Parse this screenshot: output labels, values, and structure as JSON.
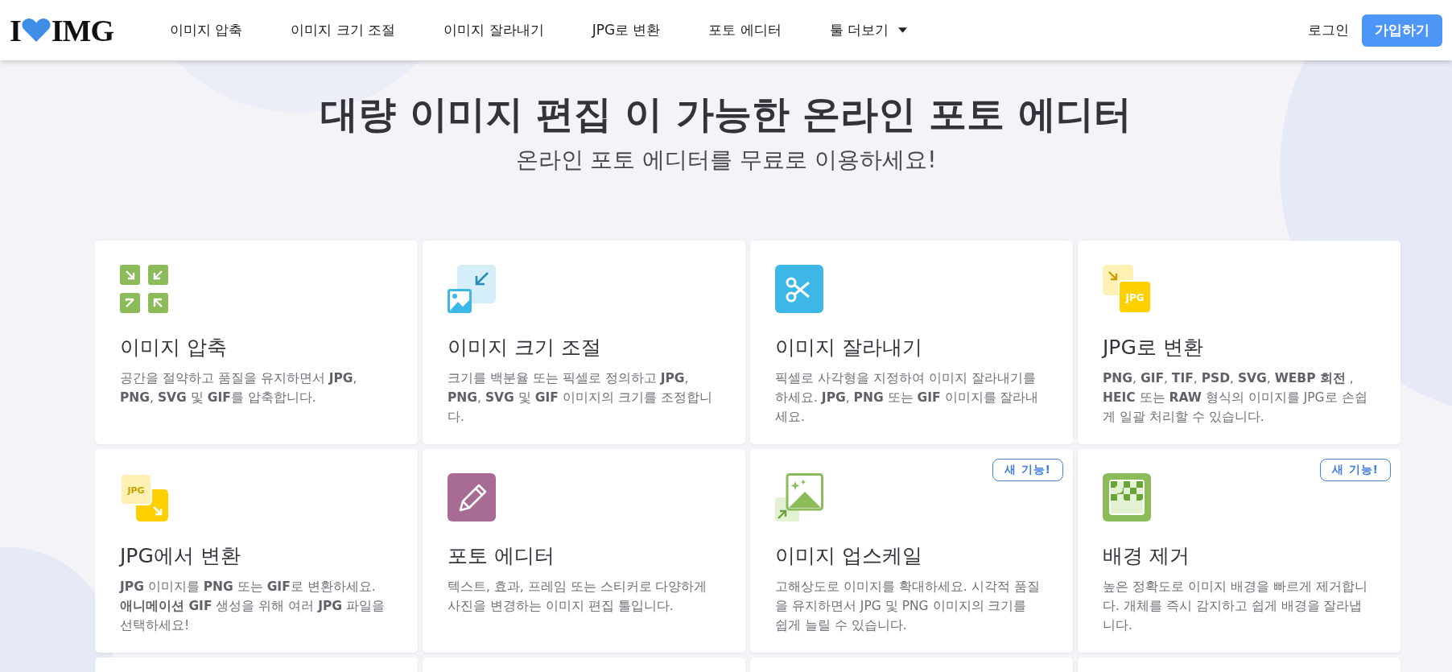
{
  "header": {
    "logo": {
      "left": "I",
      "right": "IMG"
    },
    "nav": [
      {
        "label": "이미지 압축",
        "dropdown": false
      },
      {
        "label": "이미지 크기 조절",
        "dropdown": false
      },
      {
        "label": "이미지 잘라내기",
        "dropdown": false
      },
      {
        "label": "JPG로 변환",
        "dropdown": false
      },
      {
        "label": "포토 에디터",
        "dropdown": false
      },
      {
        "label": "툴 더보기",
        "dropdown": true
      }
    ],
    "login": "로그인",
    "signup": "가입하기"
  },
  "hero": {
    "title": "대량 이미지 편집 이 가능한 온라인 포토 에디터",
    "subtitle": "온라인 포토 에디터를 무료로 이용하세요!"
  },
  "cards": [
    {
      "kind": "compress",
      "title": "이미지 압축",
      "description": "공간을 절약하고 품질을 유지하면서 **JPG**, **PNG**, **SVG** 및 **GIF**를 압축합니다."
    },
    {
      "kind": "resize",
      "title": "이미지 크기 조절",
      "description": "크기를 백분율 또는 픽셀로 정의하고 **JPG**, **PNG**, **SVG** 및 **GIF** 이미지의 크기를 조정합니다."
    },
    {
      "kind": "crop",
      "title": "이미지 잘라내기",
      "description": "픽셀로 사각형을 지정하여 이미지 잘라내기를 하세요. **JPG**, **PNG** 또는 **GIF** 이미지를 잘라내세요."
    },
    {
      "kind": "to-jpg",
      "icon_label": "JPG",
      "title": "JPG로 변환",
      "description": "**PNG**, **GIF**, **TIF**, **PSD**, **SVG**, **WEBP 회전** , **HEIC** 또는 **RAW** 형식의 이미지를 JPG로 손쉽게 일괄 처리할 수 있습니다."
    },
    {
      "kind": "from-jpg",
      "icon_label": "JPG",
      "title": "JPG에서 변환",
      "description": "**JPG** 이미지를 **PNG** 또는 **GIF**로 변환하세요. **애니메이션 GIF** 생성을 위해 여러 **JPG** 파일을 선택하세요!"
    },
    {
      "kind": "edit",
      "title": "포토 에디터",
      "description": "텍스트, 효과, 프레임 또는 스티커로 다양하게 사진을 변경하는 이미지 편집 툴입니다."
    },
    {
      "kind": "upscale",
      "badge": "새 기능!",
      "title": "이미지 업스케일",
      "description": "고해상도로 이미지를 확대하세요. 시각적 품질을 유지하면서 JPG 및 PNG 이미지의 크기를 쉽게 늘릴 수 있습니다."
    },
    {
      "kind": "remove-bg",
      "badge": "새 기능!",
      "title": "배경 제거",
      "description": "높은 정확도로 이미지 배경을 빠르게 제거합니다. 개체를 즉시 감지하고 쉽게 배경을 잘라냅니다."
    }
  ]
}
